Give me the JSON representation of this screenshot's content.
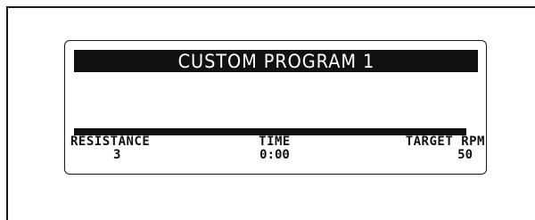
{
  "program": {
    "title": "CUSTOM PROGRAM 1",
    "progress_percent": 100
  },
  "stats": {
    "resistance": {
      "label": "RESISTANCE",
      "value": "3"
    },
    "time": {
      "label": "TIME",
      "value": "0:00"
    },
    "target_rpm": {
      "label": "TARGET RPM",
      "value": "50"
    }
  }
}
